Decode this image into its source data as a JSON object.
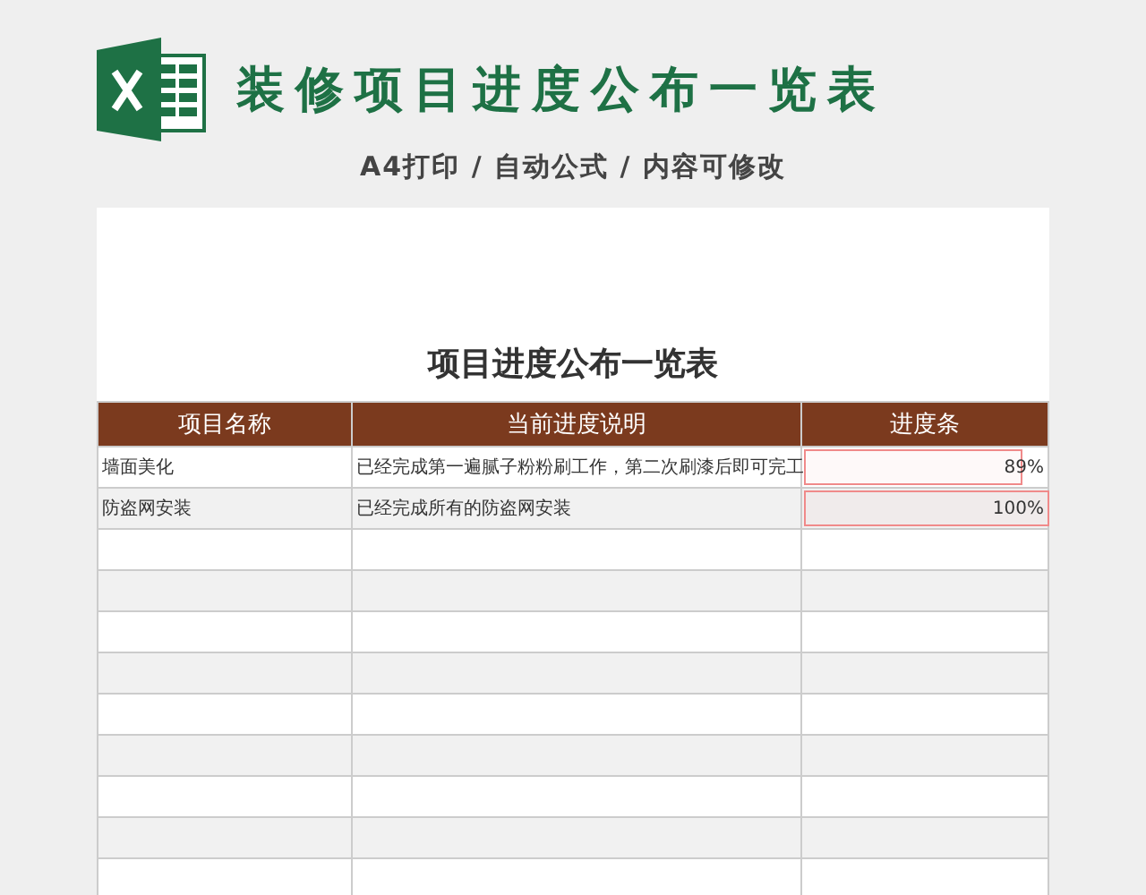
{
  "header": {
    "title": "装修项目进度公布一览表",
    "subtitle": "A4打印 / 自动公式 / 内容可修改"
  },
  "sheet": {
    "title": "项目进度公布一览表",
    "columns": [
      "项目名称",
      "当前进度说明",
      "进度条"
    ],
    "rows": [
      {
        "name": "墙面美化",
        "description": "已经完成第一遍腻子粉粉刷工作，第二次刷漆后即可完工",
        "level": 0.89,
        "reading": "89%"
      },
      {
        "name": "防盗网安装",
        "description": "已经完成所有的防盗网安装",
        "level": 1.0,
        "reading": "100%"
      }
    ]
  }
}
